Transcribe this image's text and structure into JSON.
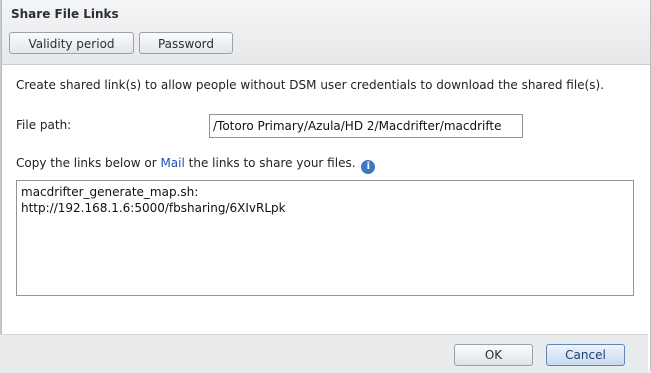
{
  "dialog": {
    "title": "Share File Links",
    "tabs": [
      {
        "label": "Validity period"
      },
      {
        "label": "Password"
      }
    ],
    "description": "Create shared link(s) to allow people without DSM user credentials to download the shared file(s).",
    "file_path": {
      "label": "File path:",
      "value": "/Totoro Primary/Azula/HD 2/Macdrifter/macdrifte"
    },
    "copy": {
      "prefix": "Copy the links below or ",
      "mail_link": "Mail",
      "suffix": " the links to share your files.",
      "info_icon": "i"
    },
    "links_text": "macdrifter_generate_map.sh:\nhttp://192.168.1.6:5000/fbsharing/6XIvRLpk",
    "buttons": {
      "ok": "OK",
      "cancel": "Cancel"
    }
  },
  "colors": {
    "link": "#1f4fb3",
    "info_icon": "#3b78c4",
    "primary_button_border": "#5d87b8"
  }
}
